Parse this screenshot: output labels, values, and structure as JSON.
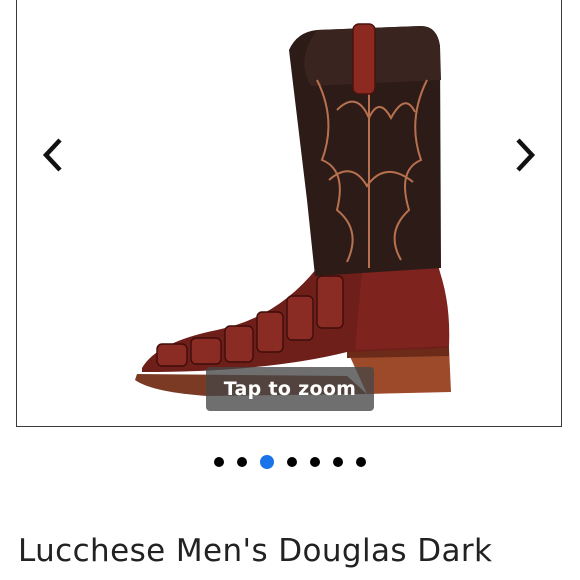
{
  "gallery": {
    "prev_icon": "chevron-left-icon",
    "next_icon": "chevron-right-icon",
    "image_subject": "boot-image",
    "zoom_hint": "Tap to zoom",
    "total_images": 7,
    "active_index": 2,
    "dot_color": "#000000",
    "active_dot_color": "#1a73e8"
  },
  "product": {
    "title": "Lucchese Men's Douglas Dark"
  }
}
